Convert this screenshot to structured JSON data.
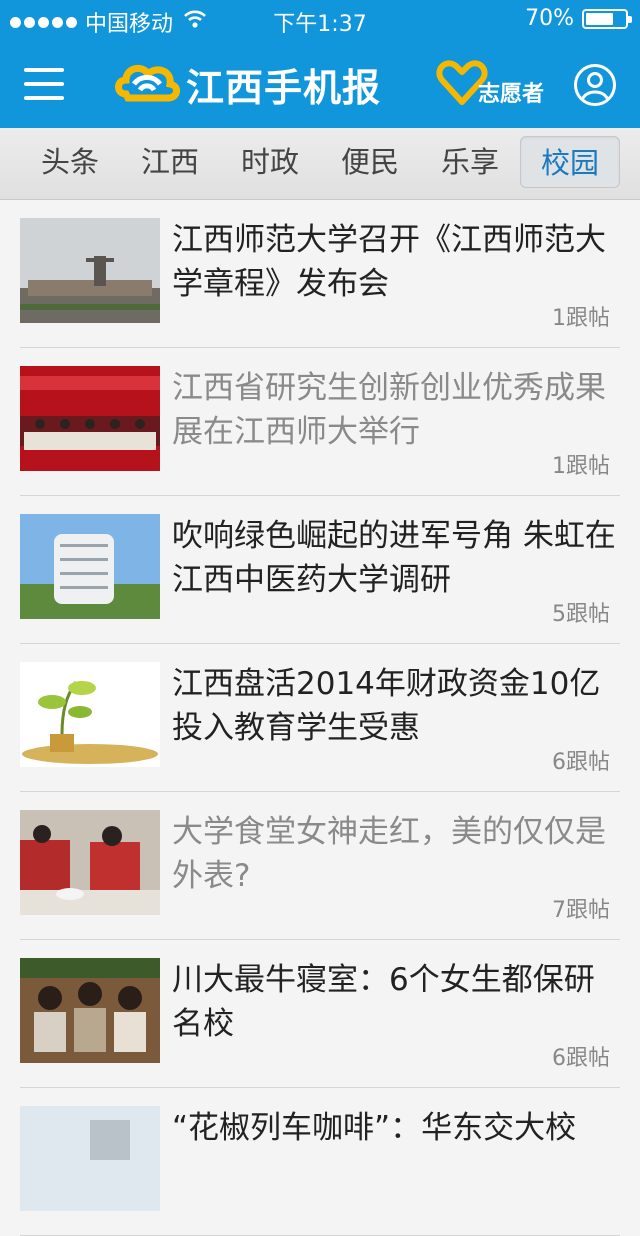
{
  "status_bar": {
    "carrier": "中国移动",
    "time": "下午1:37",
    "battery": "70%",
    "battery_level": 0.7
  },
  "header": {
    "logo_text": "江西手机报",
    "volunteer_label": "志愿者",
    "icons": [
      "menu-icon",
      "logo-cloud-icon",
      "heart-icon",
      "user-icon"
    ]
  },
  "tabs": [
    {
      "label": "头条",
      "active": false
    },
    {
      "label": "江西",
      "active": false
    },
    {
      "label": "时政",
      "active": false
    },
    {
      "label": "便民",
      "active": false
    },
    {
      "label": "乐享",
      "active": false
    },
    {
      "label": "校园",
      "active": true
    }
  ],
  "articles": [
    {
      "title": "江西师范大学召开《江西师范大学章程》发布会",
      "replies": "1跟帖",
      "read": false
    },
    {
      "title": "江西省研究生创新创业优秀成果展在江西师大举行",
      "replies": "1跟帖",
      "read": true
    },
    {
      "title": "吹响绿色崛起的进军号角 朱虹在江西中医药大学调研",
      "replies": "5跟帖",
      "read": false
    },
    {
      "title": "江西盘活2014年财政资金10亿投入教育学生受惠",
      "replies": "6跟帖",
      "read": false
    },
    {
      "title": "大学食堂女神走红，美的仅仅是外表?",
      "replies": "7跟帖",
      "read": true
    },
    {
      "title": "川大最牛寝室：6个女生都保研名校",
      "replies": "6跟帖",
      "read": false
    },
    {
      "title": "“花椒列车咖啡”：华东交大校",
      "replies": "",
      "read": false
    }
  ],
  "colors": {
    "brand_blue": "#1296db",
    "active_tab": "#1a7ac0",
    "logo_yellow": "#f5b800"
  }
}
